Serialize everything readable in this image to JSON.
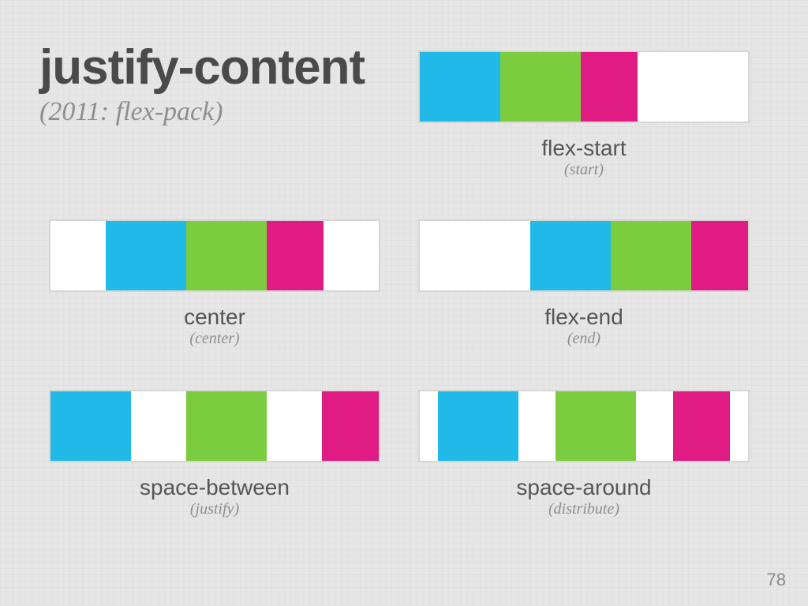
{
  "title": "justify-content",
  "subtitle": "(2011: flex-pack)",
  "page_number": "78",
  "colors": {
    "cyan": "#21bae8",
    "green": "#7bcc3e",
    "magenta": "#e01b84",
    "bg": "#e5e6e5"
  },
  "demos": {
    "flex_start": {
      "label": "flex-start",
      "alt": "(start)"
    },
    "center": {
      "label": "center",
      "alt": "(center)"
    },
    "flex_end": {
      "label": "flex-end",
      "alt": "(end)"
    },
    "between": {
      "label": "space-between",
      "alt": "(justify)"
    },
    "around": {
      "label": "space-around",
      "alt": "(distribute)"
    }
  }
}
